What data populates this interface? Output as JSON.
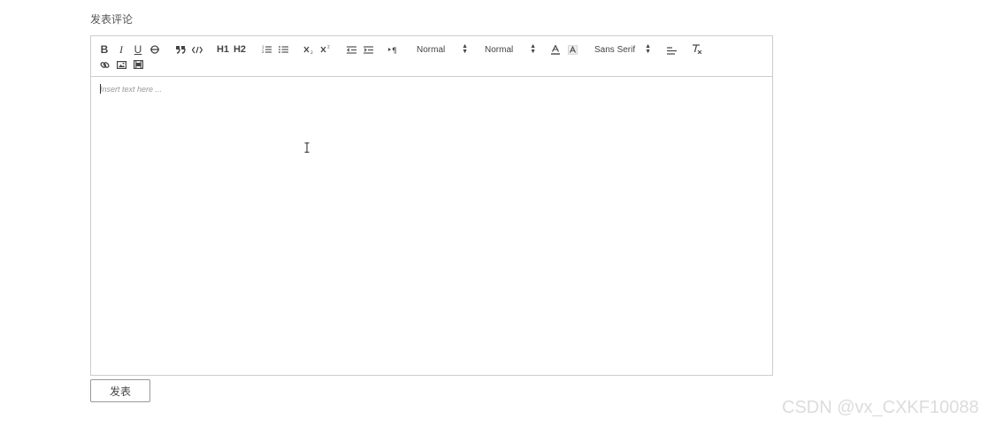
{
  "section_title": "发表评论",
  "toolbar": {
    "bold": "B",
    "italic": "I",
    "underline": "U",
    "header1": "H1",
    "header2": "H2",
    "size_picker": "Normal",
    "header_picker": "Normal",
    "font_picker": "Sans Serif",
    "icons": [
      "bold-icon",
      "italic-icon",
      "underline-icon",
      "strike-icon",
      "blockquote-icon",
      "code-block-icon",
      "header1-icon",
      "header2-icon",
      "ordered-list-icon",
      "bullet-list-icon",
      "subscript-icon",
      "superscript-icon",
      "outdent-icon",
      "indent-icon",
      "rtl-direction-icon",
      "color-icon",
      "background-icon",
      "align-icon",
      "clean-format-icon",
      "link-icon",
      "image-icon",
      "video-icon"
    ]
  },
  "editor": {
    "placeholder": "Insert text here ..."
  },
  "submit_label": "发表",
  "watermark": "CSDN @vx_CXKF10088",
  "colors": {
    "border": "#cccccc",
    "text": "#444444",
    "placeholder": "#999999"
  }
}
